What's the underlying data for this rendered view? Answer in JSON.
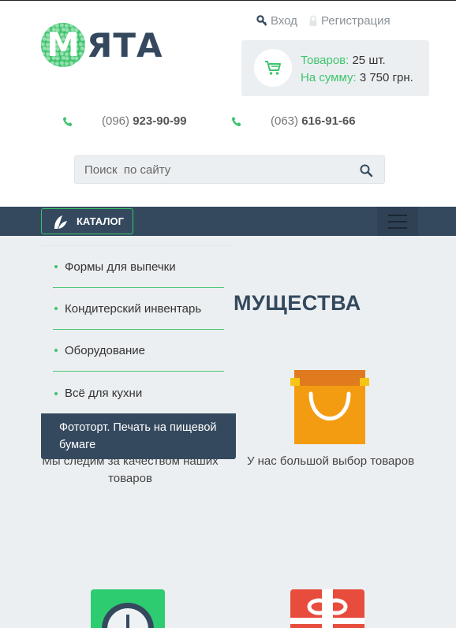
{
  "header": {
    "logo": {
      "first_letter": "М",
      "rest": "ЯТА"
    },
    "auth": {
      "login": "Вход",
      "register": "Регистрация"
    },
    "cart": {
      "items_label": "Товаров:",
      "items_value": "25 шт.",
      "sum_label": "На сумму:",
      "sum_value": "3 750 грн."
    },
    "phones": [
      {
        "prefix": "(096)",
        "number": "923-90-99"
      },
      {
        "prefix": "(063)",
        "number": "616-91-66"
      }
    ],
    "search": {
      "placeholder": "Поиск  по сайту"
    }
  },
  "navbar": {
    "catalog_label": "КАТАЛОГ"
  },
  "catalog_menu": {
    "items": [
      "Формы для выпечки",
      "Кондитерский инвентарь",
      "Оборудование",
      "Всё для кухни"
    ],
    "highlighted": "Фототорт. Печать на пищевой бумаге"
  },
  "main": {
    "section_title": "МУЩЕСТВА",
    "features": [
      {
        "label": "Мы следим за качеством наших товаров"
      },
      {
        "label": "У нас большой выбор товаров"
      }
    ]
  },
  "colors": {
    "accent": "#3ec46d",
    "dark": "#34495e",
    "bg": "#eceff1"
  }
}
